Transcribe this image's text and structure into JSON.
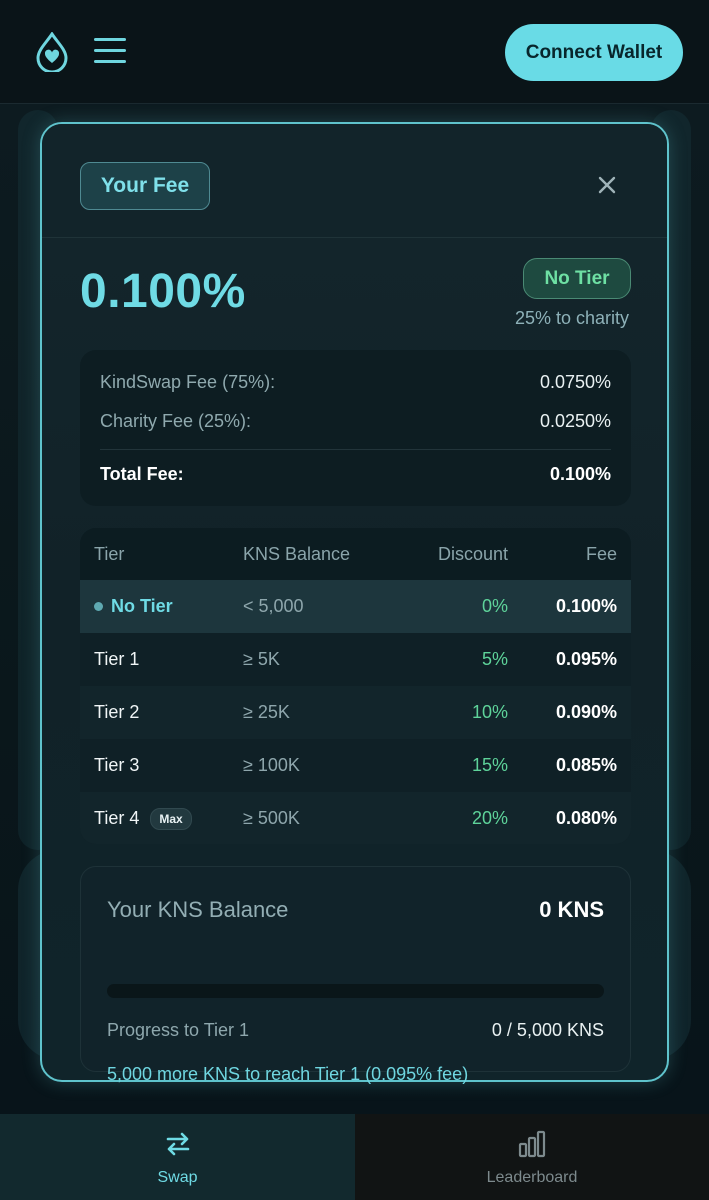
{
  "header": {
    "logo_icon": "droplet-heart-icon",
    "menu_icon": "hamburger-menu-icon",
    "connect_label": "Connect Wallet",
    "accent": "#69dbe6"
  },
  "modal": {
    "title": "Your Fee",
    "close_icon": "close-icon",
    "fee_value": "0.100%",
    "tier_badge": "No Tier",
    "charity_note": "25% to charity",
    "breakdown": {
      "rows": [
        {
          "label": "KindSwap Fee (75%):",
          "value": "0.0750%"
        },
        {
          "label": "Charity Fee (25%):",
          "value": "0.0250%"
        }
      ],
      "total_label": "Total Fee:",
      "total_value": "0.100%"
    },
    "tiers": {
      "columns": [
        "Tier",
        "KNS Balance",
        "Discount",
        "Fee"
      ],
      "rows": [
        {
          "tier": "No Tier",
          "balance": "< 5,000",
          "discount": "0%",
          "fee": "0.100%",
          "current": true
        },
        {
          "tier": "Tier 1",
          "balance": "≥ 5K",
          "discount": "5%",
          "fee": "0.095%"
        },
        {
          "tier": "Tier 2",
          "balance": "≥ 25K",
          "discount": "10%",
          "fee": "0.090%"
        },
        {
          "tier": "Tier 3",
          "balance": "≥ 100K",
          "discount": "15%",
          "fee": "0.085%"
        },
        {
          "tier": "Tier 4",
          "balance": "≥ 500K",
          "discount": "20%",
          "fee": "0.080%",
          "badge": "Max"
        }
      ]
    },
    "balance": {
      "label": "Your KNS Balance",
      "value": "0 KNS",
      "progress_fraction": 0,
      "progress_label": "Progress to Tier 1",
      "progress_value": "0 / 5,000 KNS",
      "note": "5,000 more KNS to reach Tier 1 (0.095% fee)"
    }
  },
  "bottom_nav": {
    "items": [
      {
        "label": "Swap",
        "icon": "swap-arrows-icon",
        "active": true
      },
      {
        "label": "Leaderboard",
        "icon": "bar-chart-icon",
        "active": false
      }
    ]
  }
}
